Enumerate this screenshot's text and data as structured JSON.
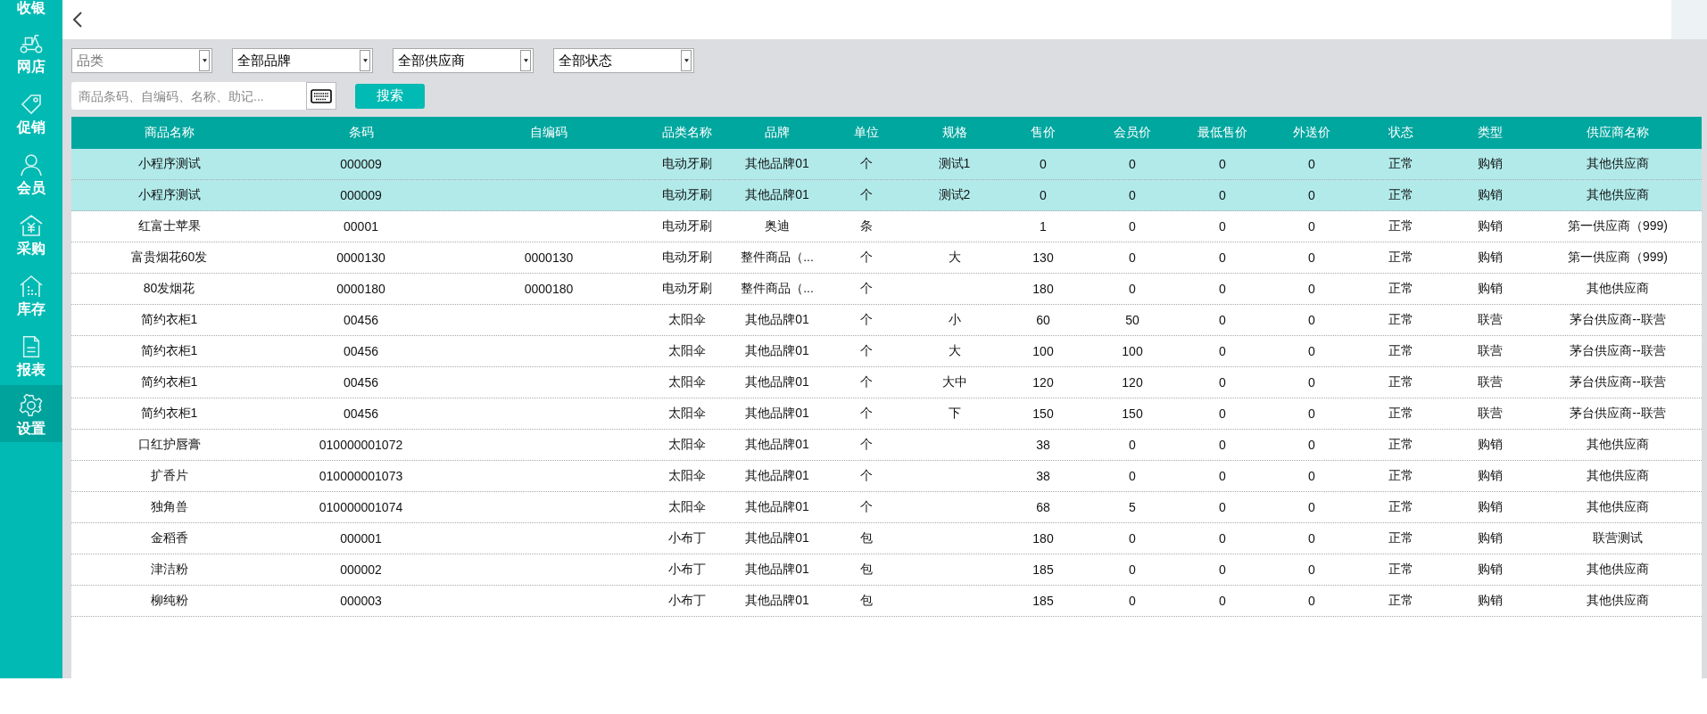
{
  "sidebar": {
    "items": [
      {
        "label": "收银",
        "selected": false
      },
      {
        "label": "网店",
        "selected": false
      },
      {
        "label": "促销",
        "selected": false
      },
      {
        "label": "会员",
        "selected": false
      },
      {
        "label": "采购",
        "selected": false
      },
      {
        "label": "库存",
        "selected": false
      },
      {
        "label": "报表",
        "selected": false
      },
      {
        "label": "设置",
        "selected": true
      }
    ]
  },
  "filters": [
    {
      "placeholder": "品类"
    },
    {
      "value": "全部品牌"
    },
    {
      "value": "全部供应商"
    },
    {
      "value": "全部状态"
    }
  ],
  "search": {
    "placeholder": "商品条码、自编码、名称、助记...",
    "button": "搜索"
  },
  "table": {
    "columns": [
      "商品名称",
      "条码",
      "自编码",
      "品类名称",
      "品牌",
      "单位",
      "规格",
      "售价",
      "会员价",
      "最低售价",
      "外送价",
      "状态",
      "类型",
      "供应商名称"
    ],
    "rows": [
      {
        "selected": true,
        "cells": [
          "小程序测试",
          "000009",
          "",
          "电动牙刷",
          "其他品牌01",
          "个",
          "测试1",
          "0",
          "0",
          "0",
          "0",
          "正常",
          "购销",
          "其他供应商"
        ]
      },
      {
        "selected": true,
        "cells": [
          "小程序测试",
          "000009",
          "",
          "电动牙刷",
          "其他品牌01",
          "个",
          "测试2",
          "0",
          "0",
          "0",
          "0",
          "正常",
          "购销",
          "其他供应商"
        ]
      },
      {
        "selected": false,
        "cells": [
          "红富士苹果",
          "00001",
          "",
          "电动牙刷",
          "奥迪",
          "条",
          "",
          "1",
          "0",
          "0",
          "0",
          "正常",
          "购销",
          "第一供应商（999)"
        ]
      },
      {
        "selected": false,
        "cells": [
          "富贵烟花60发",
          "0000130",
          "0000130",
          "电动牙刷",
          "整件商品（...",
          "个",
          "大",
          "130",
          "0",
          "0",
          "0",
          "正常",
          "购销",
          "第一供应商（999)"
        ]
      },
      {
        "selected": false,
        "cells": [
          "80发烟花",
          "0000180",
          "0000180",
          "电动牙刷",
          "整件商品（...",
          "个",
          "",
          "180",
          "0",
          "0",
          "0",
          "正常",
          "购销",
          "其他供应商"
        ]
      },
      {
        "selected": false,
        "cells": [
          "简约衣柜1",
          "00456",
          "",
          "太阳伞",
          "其他品牌01",
          "个",
          "小",
          "60",
          "50",
          "0",
          "0",
          "正常",
          "联营",
          "茅台供应商--联营"
        ]
      },
      {
        "selected": false,
        "cells": [
          "简约衣柜1",
          "00456",
          "",
          "太阳伞",
          "其他品牌01",
          "个",
          "大",
          "100",
          "100",
          "0",
          "0",
          "正常",
          "联营",
          "茅台供应商--联营"
        ]
      },
      {
        "selected": false,
        "cells": [
          "简约衣柜1",
          "00456",
          "",
          "太阳伞",
          "其他品牌01",
          "个",
          "大中",
          "120",
          "120",
          "0",
          "0",
          "正常",
          "联营",
          "茅台供应商--联营"
        ]
      },
      {
        "selected": false,
        "cells": [
          "简约衣柜1",
          "00456",
          "",
          "太阳伞",
          "其他品牌01",
          "个",
          "下",
          "150",
          "150",
          "0",
          "0",
          "正常",
          "联营",
          "茅台供应商--联营"
        ]
      },
      {
        "selected": false,
        "cells": [
          "口红护唇膏",
          "010000001072",
          "",
          "太阳伞",
          "其他品牌01",
          "个",
          "",
          "38",
          "0",
          "0",
          "0",
          "正常",
          "购销",
          "其他供应商"
        ]
      },
      {
        "selected": false,
        "cells": [
          "扩香片",
          "010000001073",
          "",
          "太阳伞",
          "其他品牌01",
          "个",
          "",
          "38",
          "0",
          "0",
          "0",
          "正常",
          "购销",
          "其他供应商"
        ]
      },
      {
        "selected": false,
        "cells": [
          "独角兽",
          "010000001074",
          "",
          "太阳伞",
          "其他品牌01",
          "个",
          "",
          "68",
          "5",
          "0",
          "0",
          "正常",
          "购销",
          "其他供应商"
        ]
      },
      {
        "selected": false,
        "cells": [
          "金稻香",
          "000001",
          "",
          "小布丁",
          "其他品牌01",
          "包",
          "",
          "180",
          "0",
          "0",
          "0",
          "正常",
          "购销",
          "联营测试"
        ]
      },
      {
        "selected": false,
        "cells": [
          "津洁粉",
          "000002",
          "",
          "小布丁",
          "其他品牌01",
          "包",
          "",
          "185",
          "0",
          "0",
          "0",
          "正常",
          "购销",
          "其他供应商"
        ]
      },
      {
        "selected": false,
        "cells": [
          "柳纯粉",
          "000003",
          "",
          "小布丁",
          "其他品牌01",
          "包",
          "",
          "185",
          "0",
          "0",
          "0",
          "正常",
          "购销",
          "其他供应商"
        ]
      }
    ]
  }
}
